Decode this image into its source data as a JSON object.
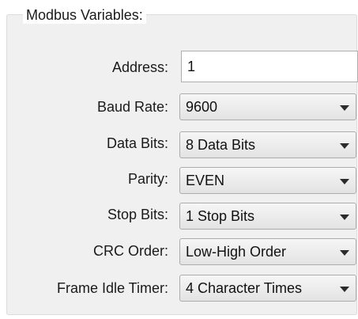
{
  "group": {
    "title": "Modbus Variables:"
  },
  "fields": {
    "address": {
      "label": "Address:",
      "value": "1"
    },
    "baud_rate": {
      "label": "Baud Rate:",
      "value": "9600",
      "icon": "chevron-down-icon"
    },
    "data_bits": {
      "label": "Data Bits:",
      "value": "8 Data Bits",
      "icon": "chevron-down-icon"
    },
    "parity": {
      "label": "Parity:",
      "value": "EVEN",
      "icon": "chevron-down-icon"
    },
    "stop_bits": {
      "label": "Stop Bits:",
      "value": "1 Stop Bits",
      "icon": "chevron-down-icon"
    },
    "crc_order": {
      "label": "CRC Order:",
      "value": "Low-High Order",
      "icon": "chevron-down-icon"
    },
    "frame_idle_timer": {
      "label": "Frame Idle Timer:",
      "value": "4 Character Times",
      "icon": "chevron-down-icon"
    }
  },
  "colors": {
    "group_background": "#f0f0f0",
    "text": "#1a1a1a",
    "field_border": "#acacac"
  }
}
